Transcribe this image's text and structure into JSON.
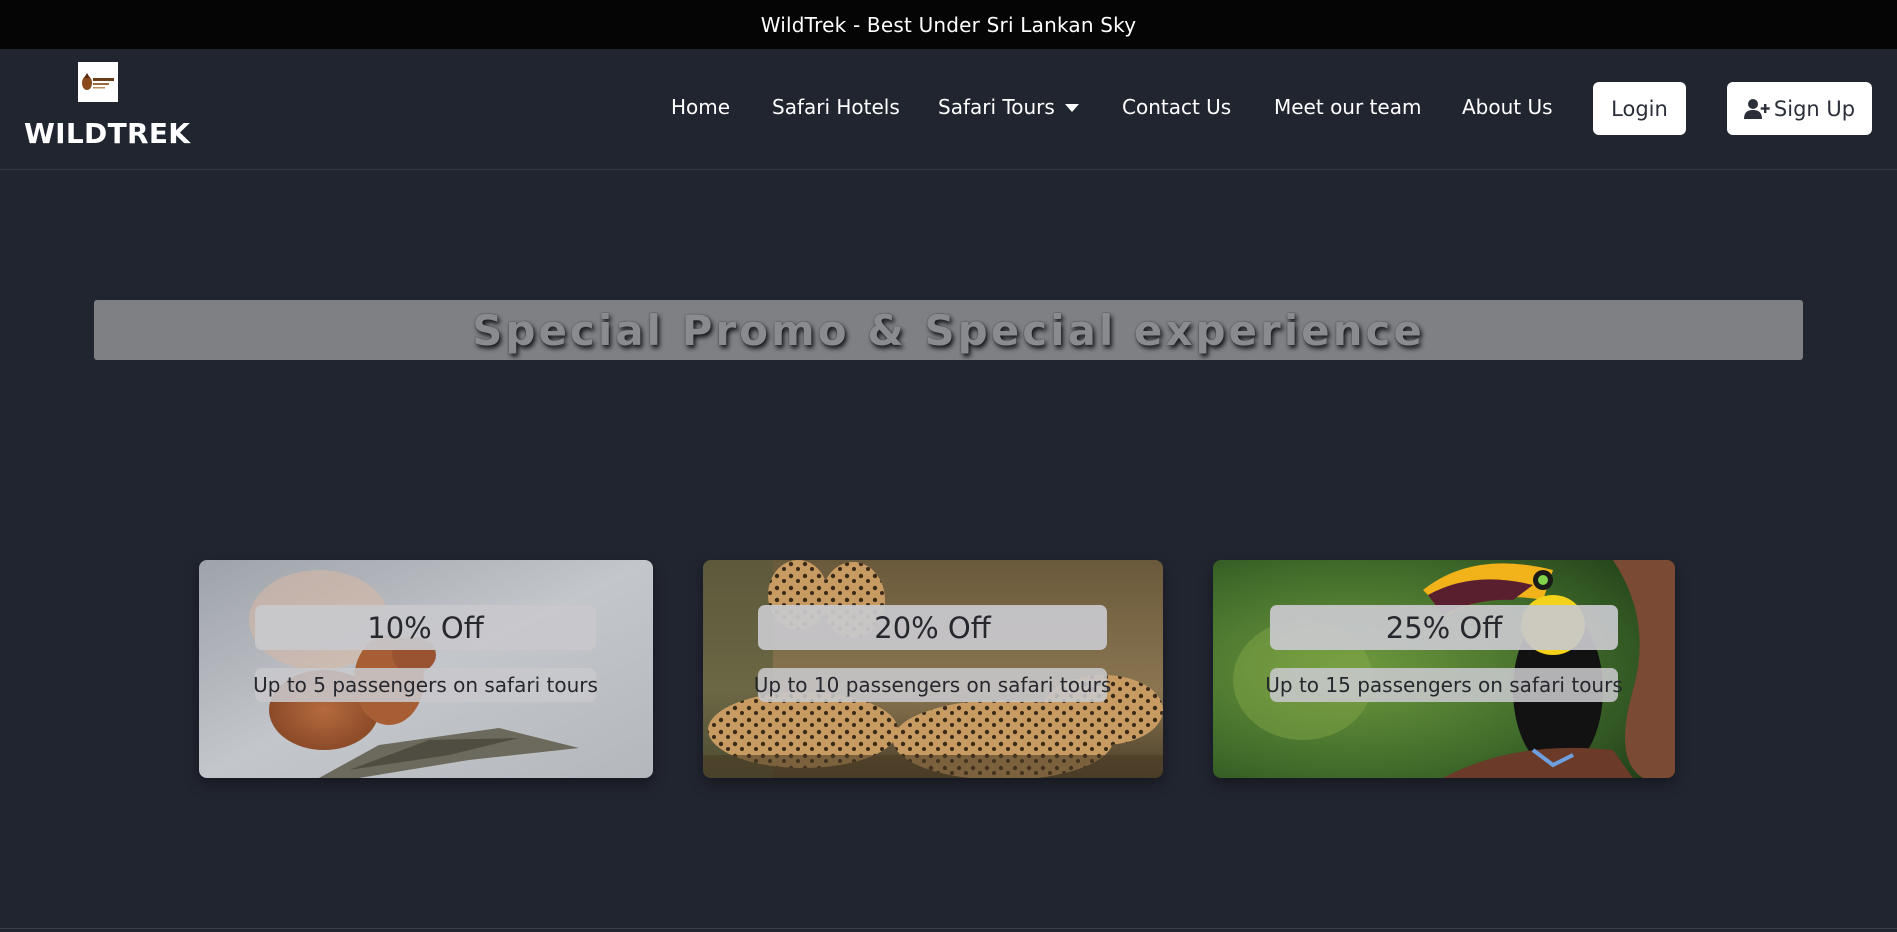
{
  "topbar": {
    "text": "WildTrek - Best Under Sri Lankan Sky"
  },
  "brand": {
    "logo_icon": "wildtrek-logo",
    "name": "WILDTREK"
  },
  "nav": {
    "items": [
      {
        "label": "Home"
      },
      {
        "label": "Safari Hotels"
      },
      {
        "label": "Safari Tours",
        "dropdown": true
      },
      {
        "label": "Contact Us"
      },
      {
        "label": "Meet our team"
      },
      {
        "label": "About Us"
      }
    ],
    "login_label": "Login",
    "signup_label": "Sign Up",
    "signup_icon": "user-plus-icon"
  },
  "promo": {
    "title": "Special Promo & Special experience",
    "cards": [
      {
        "discount": "10% Off",
        "description": "Up to 5 passengers on safari tours",
        "image": "squirrel-on-branch"
      },
      {
        "discount": "20% Off",
        "description": "Up to 10 passengers on safari tours",
        "image": "cheetahs-resting"
      },
      {
        "discount": "25% Off",
        "description": "Up to 15 passengers on safari tours",
        "image": "toucan-on-branch"
      }
    ]
  },
  "colors": {
    "background": "#212530",
    "topbar": "#050505",
    "title_bar": "#7f8084",
    "pill": "#c8c8cc"
  }
}
